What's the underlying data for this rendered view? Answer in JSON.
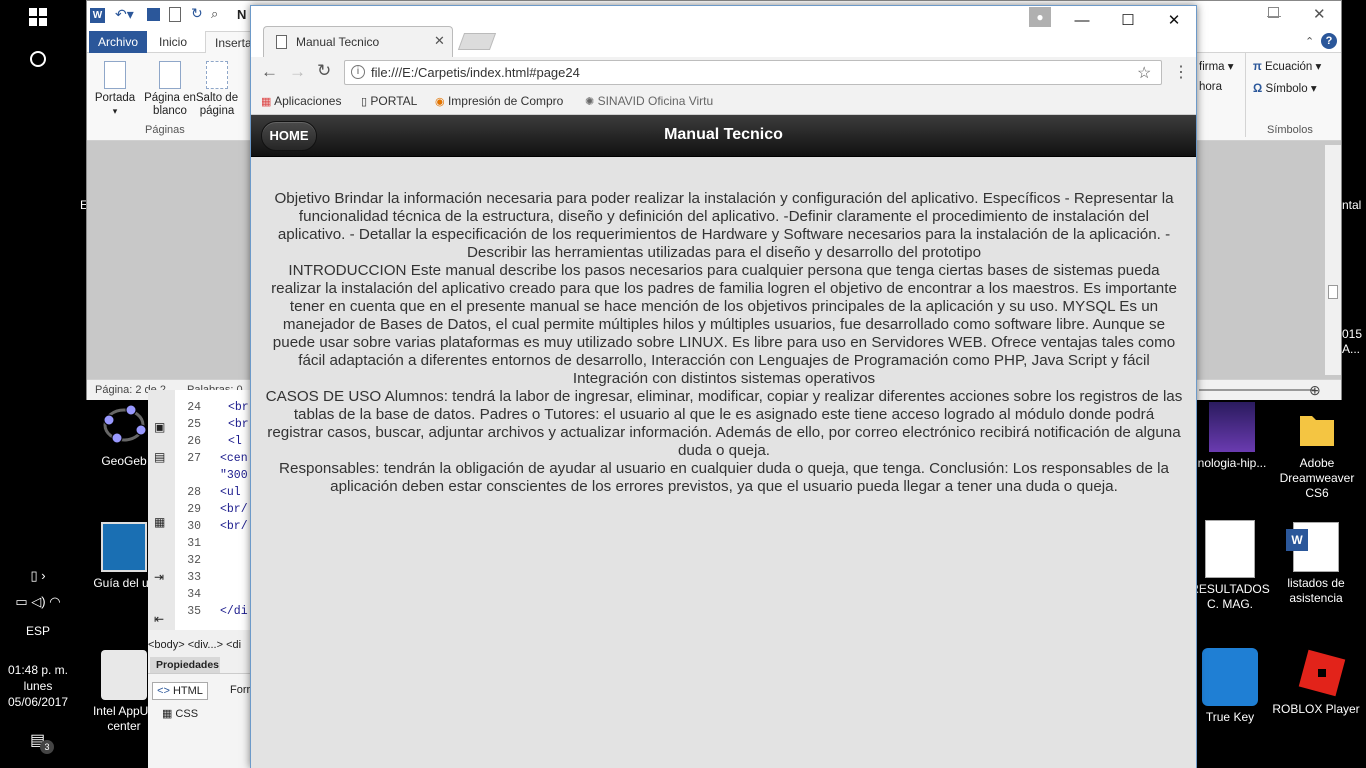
{
  "taskbar": {
    "start_icon": "windows-icon",
    "search_icon": "cortana-circle-icon",
    "language": "ESP",
    "time": "01:48 p. m.",
    "day": "lunes",
    "date": "05/06/2017",
    "notifications_count": "3"
  },
  "desktop_icons": [
    {
      "label": "GeoGeb",
      "icon": "geogebra-icon"
    },
    {
      "label": "Guía del us",
      "icon": "lenovo-guide-icon"
    },
    {
      "label": "Intel AppUp center",
      "icon": "intel-appup-icon"
    },
    {
      "label": "nologia-hip...",
      "icon": "image-file-icon"
    },
    {
      "label": "Adobe Dreamweaver CS6",
      "icon": "folder-icon"
    },
    {
      "label": "RESULTADOS C. MAG.",
      "icon": "pdf-file-icon"
    },
    {
      "label": "listados de asistencia",
      "icon": "word-file-icon"
    },
    {
      "label": "True Key",
      "icon": "true-key-icon"
    },
    {
      "label": "ROBLOX Player",
      "icon": "roblox-icon"
    },
    {
      "label": "ntal",
      "icon": "partial-label"
    },
    {
      "label": "015",
      "icon": "partial-label"
    },
    {
      "label": "A...",
      "icon": "partial-label"
    },
    {
      "label": "E",
      "icon": "partial-label"
    }
  ],
  "word": {
    "tabs": [
      "Archivo",
      "Inicio",
      "Inserta"
    ],
    "ribbon_left": [
      {
        "label": "Portada",
        "sub": "▾"
      },
      {
        "label": "Página en blanco"
      },
      {
        "label": "Salto de página"
      }
    ],
    "group_paginas": "Páginas",
    "ribbon_right": [
      {
        "label": "firma ▾"
      },
      {
        "label": "hora"
      },
      {
        "label": "Ecuación ▾"
      },
      {
        "label": "Símbolo ▾"
      }
    ],
    "group_simbolos": "Símbolos",
    "status_page": "Página: 2 de 2",
    "status_words": "Palabras: 0"
  },
  "dreamweaver": {
    "lines": [
      {
        "num": "24",
        "text": "<br"
      },
      {
        "num": "25",
        "text": "<br"
      },
      {
        "num": "26",
        "text": " <l"
      },
      {
        "num": "27",
        "text": "<cen"
      },
      {
        "num": "",
        "text": "\"300"
      },
      {
        "num": "28",
        "text": "<ul"
      },
      {
        "num": "29",
        "text": "<br/"
      },
      {
        "num": "30",
        "text": "<br/"
      },
      {
        "num": "31",
        "text": ""
      },
      {
        "num": "32",
        "text": ""
      },
      {
        "num": "33",
        "text": ""
      },
      {
        "num": "34",
        "text": ""
      },
      {
        "num": "35",
        "text": "</di"
      }
    ],
    "tag_path": "<body> <div...> <di",
    "panel_title": "Propiedades",
    "html_btn": "HTML",
    "css_btn": "CSS",
    "form_label": "Forr"
  },
  "chrome": {
    "tab_title": "Manual Tecnico",
    "url": "file:///E:/Carpetis/index.html#page24",
    "bookmarks": [
      {
        "label": "Aplicaciones",
        "icon": "apps-grid-icon"
      },
      {
        "label": "PORTAL",
        "icon": "page-icon"
      },
      {
        "label": "Impresión de Compro",
        "icon": "globe-icon"
      },
      {
        "label": "SINAVID Oficina Virtu",
        "icon": "sinavid-icon"
      }
    ]
  },
  "page": {
    "home_label": "HOME",
    "title": "Manual Tecnico",
    "paragraphs": [
      "Objetivo Brindar la información necesaria para poder realizar la instalación y configuración del aplicativo. Específicos - Representar la funcionalidad técnica de la estructura, diseño y definición del aplicativo. -Definir claramente el procedimiento de instalación del aplicativo. - Detallar la especificación de los requerimientos de Hardware y Software necesarios para la instalación de la aplicación. - Describir las herramientas utilizadas para el diseño y desarrollo del prototipo",
      "INTRODUCCION Este manual describe los pasos necesarios para cualquier persona que tenga ciertas bases de sistemas pueda realizar la instalación del aplicativo creado para que los padres de familia logren el objetivo de encontrar a los maestros. Es importante tener en cuenta que en el presente manual se hace mención de los objetivos principales de la aplicación y su uso. MYSQL Es un manejador de Bases de Datos, el cual permite múltiples hilos y múltiples usuarios, fue desarrollado como software libre. Aunque se puede usar sobre varias plataformas es muy utilizado sobre LINUX. Es libre para uso en Servidores WEB. Ofrece ventajas tales como fácil adaptación a diferentes entornos de desarrollo, Interacción con Lenguajes de Programación como PHP, Java Script y fácil Integración con distintos sistemas operativos",
      "CASOS DE USO Alumnos: tendrá la labor de ingresar, eliminar, modificar, copiar y realizar diferentes acciones sobre los registros de las tablas de la base de datos. Padres o Tutores: el usuario al que le es asignado este tiene acceso logrado al módulo donde podrá registrar casos, buscar, adjuntar archivos y actualizar información. Además de ello, por correo electrónico recibirá notificación de alguna duda o queja.",
      "Responsables: tendrán la obligación de ayudar al usuario en cualquier duda o queja, que tenga. Conclusión: Los responsables de la aplicación deben estar conscientes de los errores previstos, ya que el usuario pueda llegar a tener una duda o queja."
    ]
  }
}
